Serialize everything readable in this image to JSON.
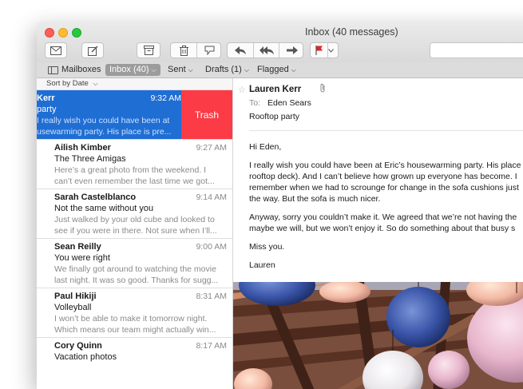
{
  "window": {
    "title": "Inbox (40 messages)"
  },
  "toolbar": {
    "icons": [
      "compose-icon",
      "get-mail-icon",
      "archive-icon",
      "trash-icon",
      "junk-icon",
      "reply-icon",
      "reply-all-icon",
      "forward-icon",
      "flag-icon",
      "search-icon"
    ],
    "flag_color": "#e0262b"
  },
  "favorites": {
    "mailboxes": "Mailboxes",
    "inbox": "Inbox (40)",
    "sent": "Sent",
    "drafts": "Drafts (1)",
    "flagged": "Flagged"
  },
  "list": {
    "sort_label": "Sort by Date",
    "swipe_action": "Trash",
    "selected_color": "#1f6ed4",
    "trash_color": "#fb3b45",
    "messages": [
      {
        "sender": "Kerr",
        "time": "9:32 AM",
        "subject": "party",
        "preview_lines": [
          "I really wish you could have been at",
          "usewarming party. His place is pre..."
        ]
      },
      {
        "sender": "Ailish Kimber",
        "time": "9:27 AM",
        "subject": "The Three Amigas",
        "preview_lines": [
          "Here’s a great photo from the weekend. I",
          "can’t even remember the last time we got..."
        ]
      },
      {
        "sender": "Sarah Castelblanco",
        "time": "9:14 AM",
        "subject": "Not the same without you",
        "preview_lines": [
          "Just walked by your old cube and looked to",
          "see if you were in there. Not sure when I’ll..."
        ]
      },
      {
        "sender": "Sean Reilly",
        "time": "9:00 AM",
        "subject": "You were right",
        "preview_lines": [
          "We finally got around to watching the movie",
          "last night. It was so good. Thanks for sugg..."
        ]
      },
      {
        "sender": "Paul Hikiji",
        "time": "8:31 AM",
        "subject": "Volleyball",
        "preview_lines": [
          "I won’t be able to make it tomorrow night.",
          "Which means our team might actually win..."
        ]
      },
      {
        "sender": "Cory Quinn",
        "time": "8:17 AM",
        "subject": "Vacation photos",
        "preview_lines": [
          "",
          ""
        ]
      }
    ]
  },
  "message": {
    "from": "Lauren Kerr",
    "to_label": "To:",
    "to": "Eden Sears",
    "subject": "Rooftop party",
    "body": [
      "Hi Eden,",
      "I really wish you could have been at Eric’s housewarming party. His place",
      "rooftop deck). And I can’t believe how grown up everyone has become. I",
      "remember when we had to scrounge for change in the sofa cushions just",
      "the way. But the sofa is much nicer.",
      "Anyway, sorry you couldn’t make it. We agreed that we’re not having the",
      "maybe we will, but we won’t enjoy it. So do something about that busy s",
      "Miss you.",
      "Lauren"
    ]
  }
}
